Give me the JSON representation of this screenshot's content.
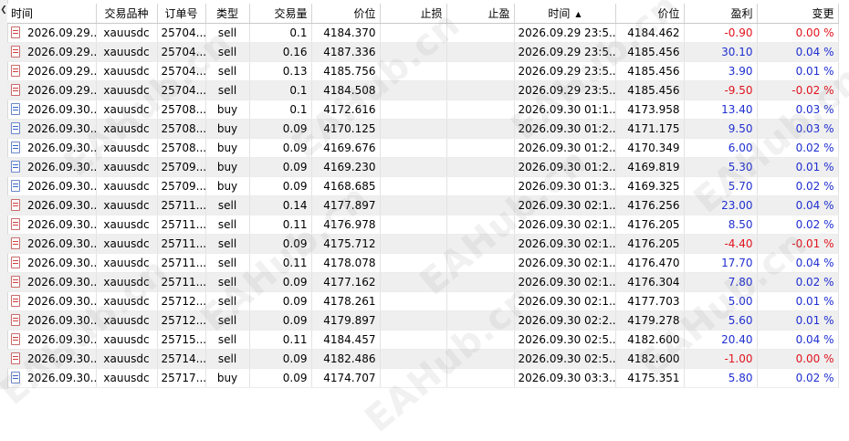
{
  "columns": [
    {
      "label": "时间",
      "align": "l"
    },
    {
      "label": "交易品种",
      "align": "c"
    },
    {
      "label": "订单号",
      "align": "c"
    },
    {
      "label": "类型",
      "align": "c"
    },
    {
      "label": "交易量",
      "align": "r"
    },
    {
      "label": "价位",
      "align": "r"
    },
    {
      "label": "止损",
      "align": "r"
    },
    {
      "label": "止盈",
      "align": "r"
    },
    {
      "label": "时间",
      "align": "c",
      "sorted": true
    },
    {
      "label": "价位",
      "align": "r"
    },
    {
      "label": "盈利",
      "align": "r"
    },
    {
      "label": "变更",
      "align": "r"
    }
  ],
  "sort_indicator": "▲",
  "watermark": "EAHub.cn",
  "rows": [
    {
      "time": "2026.09.29...",
      "symbol": "xauusdc",
      "order": "25704...",
      "type": "sell",
      "volume": "0.1",
      "price": "4184.370",
      "sl": "",
      "tp": "",
      "close_time": "2026.09.29 23:5...",
      "close_price": "4184.462",
      "profit": "-0.90",
      "change": "0.00 %",
      "profit_sign": "neg",
      "change_sign": "neg"
    },
    {
      "time": "2026.09.29...",
      "symbol": "xauusdc",
      "order": "25704...",
      "type": "sell",
      "volume": "0.16",
      "price": "4187.336",
      "sl": "",
      "tp": "",
      "close_time": "2026.09.29 23:5...",
      "close_price": "4185.456",
      "profit": "30.10",
      "change": "0.04 %",
      "profit_sign": "pos",
      "change_sign": "pos"
    },
    {
      "time": "2026.09.29...",
      "symbol": "xauusdc",
      "order": "25704...",
      "type": "sell",
      "volume": "0.13",
      "price": "4185.756",
      "sl": "",
      "tp": "",
      "close_time": "2026.09.29 23:5...",
      "close_price": "4185.456",
      "profit": "3.90",
      "change": "0.01 %",
      "profit_sign": "pos",
      "change_sign": "pos"
    },
    {
      "time": "2026.09.29...",
      "symbol": "xauusdc",
      "order": "25704...",
      "type": "sell",
      "volume": "0.1",
      "price": "4184.508",
      "sl": "",
      "tp": "",
      "close_time": "2026.09.29 23:5...",
      "close_price": "4185.456",
      "profit": "-9.50",
      "change": "-0.02 %",
      "profit_sign": "neg",
      "change_sign": "neg"
    },
    {
      "time": "2026.09.30...",
      "symbol": "xauusdc",
      "order": "25708...",
      "type": "buy",
      "volume": "0.1",
      "price": "4172.616",
      "sl": "",
      "tp": "",
      "close_time": "2026.09.30 01:1...",
      "close_price": "4173.958",
      "profit": "13.40",
      "change": "0.03 %",
      "profit_sign": "pos",
      "change_sign": "pos"
    },
    {
      "time": "2026.09.30...",
      "symbol": "xauusdc",
      "order": "25708...",
      "type": "buy",
      "volume": "0.09",
      "price": "4170.125",
      "sl": "",
      "tp": "",
      "close_time": "2026.09.30 01:2...",
      "close_price": "4171.175",
      "profit": "9.50",
      "change": "0.03 %",
      "profit_sign": "pos",
      "change_sign": "pos"
    },
    {
      "time": "2026.09.30...",
      "symbol": "xauusdc",
      "order": "25708...",
      "type": "buy",
      "volume": "0.09",
      "price": "4169.676",
      "sl": "",
      "tp": "",
      "close_time": "2026.09.30 01:2...",
      "close_price": "4170.349",
      "profit": "6.00",
      "change": "0.02 %",
      "profit_sign": "pos",
      "change_sign": "pos"
    },
    {
      "time": "2026.09.30...",
      "symbol": "xauusdc",
      "order": "25709...",
      "type": "buy",
      "volume": "0.09",
      "price": "4169.230",
      "sl": "",
      "tp": "",
      "close_time": "2026.09.30 01:2...",
      "close_price": "4169.819",
      "profit": "5.30",
      "change": "0.01 %",
      "profit_sign": "pos",
      "change_sign": "pos"
    },
    {
      "time": "2026.09.30...",
      "symbol": "xauusdc",
      "order": "25709...",
      "type": "buy",
      "volume": "0.09",
      "price": "4168.685",
      "sl": "",
      "tp": "",
      "close_time": "2026.09.30 01:3...",
      "close_price": "4169.325",
      "profit": "5.70",
      "change": "0.02 %",
      "profit_sign": "pos",
      "change_sign": "pos"
    },
    {
      "time": "2026.09.30...",
      "symbol": "xauusdc",
      "order": "25711...",
      "type": "sell",
      "volume": "0.14",
      "price": "4177.897",
      "sl": "",
      "tp": "",
      "close_time": "2026.09.30 02:1...",
      "close_price": "4176.256",
      "profit": "23.00",
      "change": "0.04 %",
      "profit_sign": "pos",
      "change_sign": "pos"
    },
    {
      "time": "2026.09.30...",
      "symbol": "xauusdc",
      "order": "25711...",
      "type": "sell",
      "volume": "0.11",
      "price": "4176.978",
      "sl": "",
      "tp": "",
      "close_time": "2026.09.30 02:1...",
      "close_price": "4176.205",
      "profit": "8.50",
      "change": "0.02 %",
      "profit_sign": "pos",
      "change_sign": "pos"
    },
    {
      "time": "2026.09.30...",
      "symbol": "xauusdc",
      "order": "25711...",
      "type": "sell",
      "volume": "0.09",
      "price": "4175.712",
      "sl": "",
      "tp": "",
      "close_time": "2026.09.30 02:1...",
      "close_price": "4176.205",
      "profit": "-4.40",
      "change": "-0.01 %",
      "profit_sign": "neg",
      "change_sign": "neg"
    },
    {
      "time": "2026.09.30...",
      "symbol": "xauusdc",
      "order": "25711...",
      "type": "sell",
      "volume": "0.11",
      "price": "4178.078",
      "sl": "",
      "tp": "",
      "close_time": "2026.09.30 02:1...",
      "close_price": "4176.470",
      "profit": "17.70",
      "change": "0.04 %",
      "profit_sign": "pos",
      "change_sign": "pos"
    },
    {
      "time": "2026.09.30...",
      "symbol": "xauusdc",
      "order": "25711...",
      "type": "sell",
      "volume": "0.09",
      "price": "4177.162",
      "sl": "",
      "tp": "",
      "close_time": "2026.09.30 02:1...",
      "close_price": "4176.304",
      "profit": "7.80",
      "change": "0.02 %",
      "profit_sign": "pos",
      "change_sign": "pos"
    },
    {
      "time": "2026.09.30...",
      "symbol": "xauusdc",
      "order": "25712...",
      "type": "sell",
      "volume": "0.09",
      "price": "4178.261",
      "sl": "",
      "tp": "",
      "close_time": "2026.09.30 02:1...",
      "close_price": "4177.703",
      "profit": "5.00",
      "change": "0.01 %",
      "profit_sign": "pos",
      "change_sign": "pos"
    },
    {
      "time": "2026.09.30...",
      "symbol": "xauusdc",
      "order": "25712...",
      "type": "sell",
      "volume": "0.09",
      "price": "4179.897",
      "sl": "",
      "tp": "",
      "close_time": "2026.09.30 02:2...",
      "close_price": "4179.278",
      "profit": "5.60",
      "change": "0.01 %",
      "profit_sign": "pos",
      "change_sign": "pos"
    },
    {
      "time": "2026.09.30...",
      "symbol": "xauusdc",
      "order": "25715...",
      "type": "sell",
      "volume": "0.11",
      "price": "4184.457",
      "sl": "",
      "tp": "",
      "close_time": "2026.09.30 02:5...",
      "close_price": "4182.600",
      "profit": "20.40",
      "change": "0.04 %",
      "profit_sign": "pos",
      "change_sign": "pos"
    },
    {
      "time": "2026.09.30...",
      "symbol": "xauusdc",
      "order": "25714...",
      "type": "sell",
      "volume": "0.09",
      "price": "4182.486",
      "sl": "",
      "tp": "",
      "close_time": "2026.09.30 02:5...",
      "close_price": "4182.600",
      "profit": "-1.00",
      "change": "0.00 %",
      "profit_sign": "neg",
      "change_sign": "neg"
    },
    {
      "time": "2026.09.30...",
      "symbol": "xauusdc",
      "order": "25717...",
      "type": "buy",
      "volume": "0.09",
      "price": "4174.707",
      "sl": "",
      "tp": "",
      "close_time": "2026.09.30 03:3...",
      "close_price": "4175.351",
      "profit": "5.80",
      "change": "0.02 %",
      "profit_sign": "pos",
      "change_sign": "pos"
    }
  ]
}
